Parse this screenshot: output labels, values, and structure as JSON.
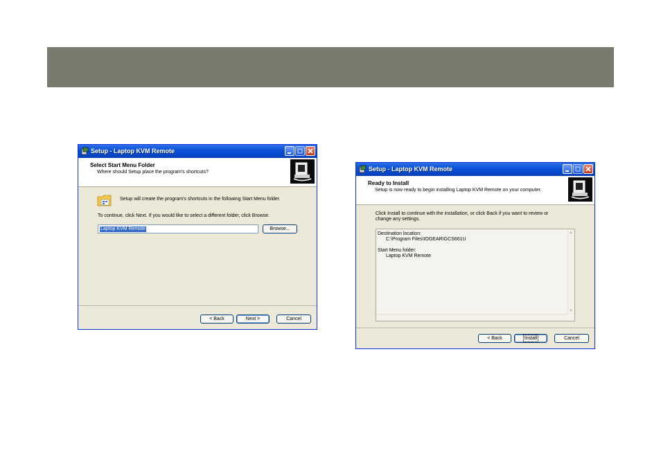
{
  "left_dialog": {
    "title": "Setup - Laptop KVM Remote",
    "header_title": "Select Start Menu Folder",
    "header_subtitle": "Where should Setup place the program's shortcuts?",
    "info_text": "Setup will create the program's shortcuts in the following Start Menu folder.",
    "continue_text": "To continue, click Next. If you would like to select a different folder, click Browse.",
    "folder_value": "Laptop KVM Remote",
    "browse_label": "Browse...",
    "back_label": "< Back",
    "next_label": "Next >",
    "cancel_label": "Cancel"
  },
  "right_dialog": {
    "title": "Setup - Laptop KVM Remote",
    "header_title": "Ready to Install",
    "header_subtitle": "Setup is now ready to begin installing Laptop KVM Remote on your computer.",
    "info_line1": "Click Install to continue with the installation, or click Back if you want to review or",
    "info_line2": "change any settings.",
    "dest_label": "Destination location:",
    "dest_value": "C:\\Program Files\\IOGEAR\\GCS661U",
    "startmenu_label": "Start Menu folder:",
    "startmenu_value": "Laptop KVM Remote",
    "back_label": "< Back",
    "install_label": "Install",
    "cancel_label": "Cancel"
  },
  "icons": [
    "setup-app-icon",
    "minimize-icon",
    "maximize-icon",
    "close-icon",
    "installer-logo-icon",
    "folder-icon",
    "scroll-up-icon",
    "scroll-down-icon"
  ],
  "colors": {
    "band": "#7a7a6e",
    "titlebar": "#0a4fd6",
    "dialog_bg": "#ece9d8",
    "selection": "#316ac5"
  }
}
